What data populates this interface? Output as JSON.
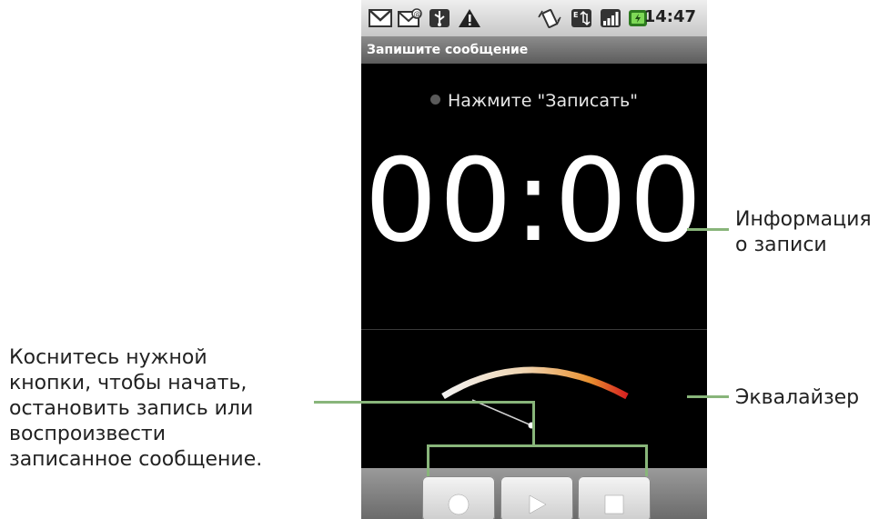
{
  "status_bar": {
    "time": "14:47",
    "icons": [
      "gmail-icon",
      "email-icon",
      "usb-icon",
      "warning-icon",
      "vibrate-icon",
      "data-transfer-icon",
      "signal-icon",
      "battery-icon"
    ]
  },
  "window_title": "Запишите сообщение",
  "recorder": {
    "state_text": "Нажмите \"Записать\"",
    "timer": "00:00"
  },
  "controls": {
    "icons": [
      "record-icon",
      "play-icon",
      "stop-icon"
    ]
  },
  "annotations": {
    "recording_info": [
      "Информация",
      "о записи"
    ],
    "equalizer": "Эквалайзер",
    "buttons": [
      "Коснитесь нужной",
      "кнопки, чтобы начать,",
      "остановить запись или",
      "воспроизвести",
      "записанное сообщение."
    ]
  },
  "colors": {
    "callout_line": "#88b57a",
    "vu_arc_start": "#f0f0f0",
    "vu_arc_end": "#d62020"
  }
}
